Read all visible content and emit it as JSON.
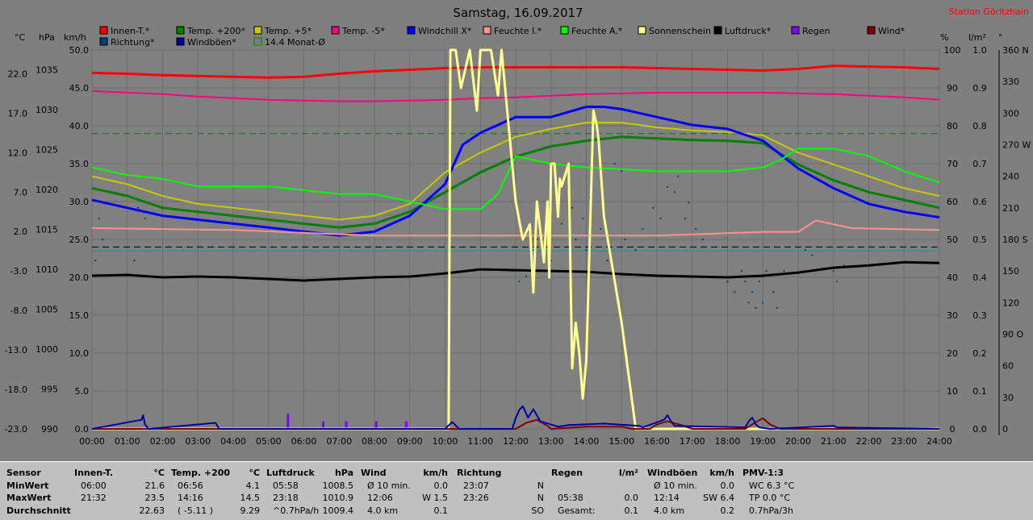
{
  "title": "Samstag, 16.09.2017",
  "station": "Station Göritzhain",
  "units": {
    "celsius": "°C",
    "hpa": "hPa",
    "kmh": "km/h",
    "percent": "%",
    "lm2": "l/m²",
    "degree": "°"
  },
  "legend": [
    {
      "label": "Innen-T.*",
      "color": "#ff0000"
    },
    {
      "label": "Temp. +200*",
      "color": "#008000"
    },
    {
      "label": "Temp. +5*",
      "color": "#c8c800"
    },
    {
      "label": "Temp. -5*",
      "color": "#ff0080"
    },
    {
      "label": "Windchill X*",
      "color": "#0000ff"
    },
    {
      "label": "Feuchte I.*",
      "color": "#ff9090"
    },
    {
      "label": "Feuchte A.*",
      "color": "#00ff00"
    },
    {
      "label": "Sonnenschein",
      "color": "#ffff90"
    },
    {
      "label": "Luftdruck*",
      "color": "#000000"
    },
    {
      "label": "Regen",
      "color": "#8000ff"
    },
    {
      "label": "Wind*",
      "color": "#800000"
    },
    {
      "label": "Richtung*",
      "color": "#004080"
    },
    {
      "label": "Windböen*",
      "color": "#0000a0"
    },
    {
      "label": "14.4 Monat-Ø",
      "color": "#008000",
      "outline": true
    }
  ],
  "chart_data": {
    "type": "line",
    "title": "Samstag, 16.09.2017",
    "x_ticks": [
      "00:00",
      "01:00",
      "02:00",
      "03:00",
      "04:00",
      "05:00",
      "06:00",
      "07:00",
      "08:00",
      "09:00",
      "10:00",
      "11:00",
      "12:00",
      "13:00",
      "14:00",
      "15:00",
      "16:00",
      "17:00",
      "18:00",
      "19:00",
      "20:00",
      "21:00",
      "22:00",
      "23:00",
      "24:00"
    ],
    "xlim": [
      0,
      24
    ],
    "axes": {
      "celsius": {
        "ticks": [
          "22.0",
          "17.0",
          "12.0",
          "7.0",
          "2.0",
          "-3.0",
          "-8.0",
          "-13.0",
          "-18.0",
          "-23.0"
        ],
        "ylim": [
          -23,
          25
        ]
      },
      "hpa": {
        "ticks": [
          "1035",
          "1030",
          "1025",
          "1020",
          "1015",
          "1010",
          "1005",
          "1000",
          "995",
          "990"
        ],
        "ylim": [
          990,
          1037.5
        ]
      },
      "kmh": {
        "ticks": [
          "50.0",
          "45.0",
          "40.0",
          "35.0",
          "30.0",
          "25.0",
          "20.0",
          "15.0",
          "10.0",
          "5.0",
          "0.0"
        ],
        "ylim": [
          0,
          50
        ]
      },
      "percent": {
        "ticks": [
          "100",
          "90",
          "80",
          "70",
          "60",
          "50",
          "40",
          "30",
          "20",
          "10",
          "0"
        ],
        "ylim": [
          0,
          100
        ]
      },
      "lm2": {
        "ticks": [
          "1.0",
          "0.9",
          "0.8",
          "0.7",
          "0.6",
          "0.5",
          "0.4",
          "0.3",
          "0.2",
          "0.1",
          "0.0"
        ],
        "ylim": [
          0,
          1
        ]
      },
      "degree": {
        "ticks": [
          "360 N",
          "330",
          "300",
          "270 W",
          "240",
          "210",
          "180 S",
          "150",
          "120",
          "90 O",
          "60",
          "30",
          "0"
        ],
        "ylim": [
          0,
          360
        ]
      }
    },
    "reference_lines": [
      {
        "name": "14.4 Monat-Ø",
        "y_celsius": 14.4,
        "color": "#008000",
        "style": "dashed"
      },
      {
        "y_kmh": 24.0,
        "color": "#000000",
        "style": "dashed"
      },
      {
        "y_kmh": 23.5,
        "color": "#00a0a0",
        "style": "solid"
      }
    ],
    "series": [
      {
        "name": "Innen-T.*",
        "axis": "celsius",
        "color": "#ff0000",
        "width": 3,
        "x": [
          0,
          1,
          2,
          3,
          4,
          5,
          6,
          7,
          8,
          9,
          10,
          11,
          12,
          13,
          14,
          15,
          16,
          17,
          18,
          19,
          20,
          21,
          22,
          23,
          24
        ],
        "y": [
          22.1,
          22.0,
          21.8,
          21.7,
          21.6,
          21.5,
          21.6,
          22.0,
          22.3,
          22.5,
          22.7,
          22.8,
          22.8,
          22.8,
          22.8,
          22.8,
          22.7,
          22.6,
          22.5,
          22.4,
          22.6,
          23.0,
          22.9,
          22.8,
          22.6
        ]
      },
      {
        "name": "Temp. -5*",
        "axis": "celsius",
        "color": "#ff0080",
        "width": 2,
        "x": [
          0,
          1,
          2,
          3,
          4,
          5,
          6,
          7,
          8,
          9,
          10,
          11,
          12,
          13,
          14,
          15,
          16,
          17,
          18,
          19,
          20,
          21,
          22,
          23,
          24
        ],
        "y": [
          19.8,
          19.6,
          19.4,
          19.1,
          18.9,
          18.7,
          18.6,
          18.5,
          18.5,
          18.6,
          18.7,
          18.9,
          19.0,
          19.2,
          19.4,
          19.5,
          19.6,
          19.6,
          19.6,
          19.6,
          19.5,
          19.4,
          19.2,
          19.0,
          18.7
        ]
      },
      {
        "name": "Temp. +5*",
        "axis": "celsius",
        "color": "#c8c800",
        "width": 2,
        "x": [
          0,
          1,
          2,
          3,
          4,
          5,
          6,
          7,
          8,
          9,
          10,
          11,
          12,
          13,
          14,
          15,
          16,
          17,
          18,
          19,
          20,
          21,
          22,
          23,
          24
        ],
        "y": [
          9.0,
          8.0,
          6.5,
          5.5,
          5.0,
          4.5,
          4.0,
          3.5,
          4.0,
          5.5,
          9.5,
          12.0,
          14.0,
          15.0,
          15.8,
          15.8,
          15.2,
          14.8,
          14.6,
          14.2,
          12.0,
          10.5,
          9.0,
          7.5,
          6.5
        ]
      },
      {
        "name": "Temp. +200*",
        "axis": "celsius",
        "color": "#008000",
        "width": 3,
        "x": [
          0,
          1,
          2,
          3,
          4,
          5,
          6,
          7,
          8,
          9,
          10,
          11,
          12,
          13,
          14,
          15,
          16,
          17,
          18,
          19,
          20,
          21,
          22,
          23,
          24
        ],
        "y": [
          7.5,
          6.5,
          5.0,
          4.5,
          4.0,
          3.5,
          3.0,
          2.5,
          3.0,
          4.5,
          7.0,
          9.5,
          11.5,
          12.8,
          13.5,
          14.0,
          13.8,
          13.6,
          13.5,
          13.2,
          10.5,
          8.5,
          7.0,
          6.0,
          5.0
        ]
      },
      {
        "name": "Windchill X*",
        "axis": "celsius",
        "color": "#0000ff",
        "width": 3,
        "x": [
          0,
          1,
          2,
          3,
          4,
          5,
          6,
          7,
          8,
          9,
          10,
          10.5,
          11,
          12,
          13,
          14,
          14.5,
          15,
          16,
          17,
          18,
          19,
          20,
          21,
          22,
          23,
          24
        ],
        "y": [
          6.0,
          5.0,
          4.0,
          3.5,
          3.0,
          2.5,
          2.0,
          1.5,
          2.0,
          4.0,
          8.0,
          13.0,
          14.5,
          16.5,
          16.5,
          17.8,
          17.8,
          17.5,
          16.5,
          15.5,
          15.0,
          13.5,
          10.0,
          7.5,
          5.5,
          4.5,
          3.8
        ]
      },
      {
        "name": "Feuchte I.*",
        "axis": "percent",
        "color": "#ff9090",
        "width": 2,
        "x": [
          0,
          4,
          8,
          9,
          12,
          16,
          19,
          20,
          20.5,
          21.5,
          24
        ],
        "y": [
          53,
          52.5,
          51,
          51,
          51,
          51,
          52,
          52,
          55,
          53,
          52.5
        ]
      },
      {
        "name": "Feuchte A.*",
        "axis": "percent",
        "color": "#00ff00",
        "width": 2,
        "x": [
          0,
          1,
          2,
          3,
          4,
          5,
          6,
          7,
          8,
          9,
          10,
          11,
          11.5,
          12,
          13,
          14,
          15,
          16,
          17,
          18,
          19,
          19.5,
          20,
          21,
          22,
          23,
          24
        ],
        "y": [
          69,
          67,
          66,
          64,
          64,
          64,
          63,
          62,
          62,
          60,
          58,
          58,
          62,
          72,
          70,
          69,
          68.5,
          68,
          68,
          68,
          69,
          71,
          74,
          74,
          72,
          68,
          65
        ]
      },
      {
        "name": "Luftdruck*",
        "axis": "hpa",
        "color": "#000000",
        "width": 3,
        "x": [
          0,
          1,
          2,
          3,
          4,
          5,
          6,
          7,
          8,
          9,
          10,
          11,
          12,
          13,
          14,
          15,
          16,
          17,
          18,
          19,
          20,
          21,
          22,
          23,
          24
        ],
        "y": [
          1009.2,
          1009.3,
          1009.0,
          1009.1,
          1009.0,
          1008.8,
          1008.6,
          1008.8,
          1009.0,
          1009.1,
          1009.5,
          1010.0,
          1009.9,
          1009.8,
          1009.7,
          1009.4,
          1009.2,
          1009.1,
          1009.0,
          1009.2,
          1009.6,
          1010.2,
          1010.5,
          1010.9,
          1010.8
        ]
      },
      {
        "name": "Sonnenschein",
        "axis": "kmh",
        "color": "#ffff90",
        "width": 3,
        "x": [
          0,
          10.1,
          10.15,
          10.3,
          10.45,
          10.7,
          10.9,
          11.0,
          11.3,
          11.5,
          11.6,
          11.9,
          12.0,
          12.2,
          12.4,
          12.5,
          12.6,
          12.8,
          12.9,
          12.95,
          13.0,
          13.1,
          13.2,
          13.25,
          13.3,
          13.5,
          13.6,
          13.7,
          13.8,
          13.9,
          14.0,
          14.2,
          14.3,
          14.35,
          14.5,
          15.0,
          15.4,
          24
        ],
        "y": [
          0,
          0,
          50,
          50,
          45,
          50,
          42,
          50,
          50,
          44,
          50,
          35,
          30,
          25,
          27,
          18,
          30,
          22,
          30,
          20,
          35,
          35,
          28,
          33,
          32,
          35,
          8,
          14,
          10,
          4,
          9,
          42,
          40,
          38,
          28,
          14,
          0,
          0
        ]
      },
      {
        "name": "Wind*",
        "axis": "kmh",
        "color": "#800000",
        "width": 2,
        "x": [
          0,
          12,
          12.3,
          12.6,
          12.9,
          13,
          14,
          15,
          15.3,
          15.8,
          16,
          16.3,
          16.7,
          17,
          18.5,
          18.8,
          19,
          19.2,
          19.5,
          24
        ],
        "y": [
          0,
          0,
          0.8,
          1.2,
          0.4,
          0,
          0.3,
          0.3,
          0,
          0,
          0.6,
          1.0,
          0.5,
          0,
          0,
          0.9,
          1.4,
          0.6,
          0,
          0
        ]
      },
      {
        "name": "Windböen*",
        "axis": "kmh",
        "color": "#0000a0",
        "width": 2,
        "x": [
          0,
          1.4,
          1.45,
          1.5,
          1.6,
          3.5,
          3.55,
          3.6,
          10,
          10.2,
          10.4,
          11.9,
          12,
          12.1,
          12.2,
          12.35,
          12.5,
          12.7,
          13.2,
          13.5,
          14.5,
          15.5,
          15.6,
          16.2,
          16.3,
          16.4,
          16.5,
          18.5,
          18.6,
          18.7,
          18.8,
          18.9,
          19.2,
          21,
          21.1,
          24
        ],
        "y": [
          0,
          1.2,
          1.8,
          0.6,
          0,
          0.8,
          0.4,
          0,
          0,
          0.9,
          0,
          0,
          1.4,
          2.5,
          3.0,
          1.5,
          2.6,
          1.0,
          0.3,
          0.5,
          0.7,
          0.4,
          0.2,
          1.2,
          1.8,
          1.0,
          0.4,
          0.2,
          1.0,
          1.5,
          0.6,
          0.2,
          0,
          0.4,
          0.2,
          0
        ]
      }
    ],
    "richtung_points": {
      "axis": "degree",
      "color": "#004080",
      "points": [
        [
          0.2,
          200
        ],
        [
          0.3,
          180
        ],
        [
          1.3,
          210
        ],
        [
          1.5,
          200
        ],
        [
          0.1,
          160
        ],
        [
          1.2,
          160
        ],
        [
          11.9,
          150
        ],
        [
          12.1,
          140
        ],
        [
          12.3,
          145
        ],
        [
          12.5,
          170
        ],
        [
          12.6,
          180
        ],
        [
          12.8,
          170
        ],
        [
          13.0,
          160
        ],
        [
          13.3,
          195
        ],
        [
          13.6,
          210
        ],
        [
          13.7,
          180
        ],
        [
          13.9,
          200
        ],
        [
          14.0,
          170
        ],
        [
          14.1,
          220
        ],
        [
          14.4,
          190
        ],
        [
          14.6,
          160
        ],
        [
          15.1,
          180
        ],
        [
          15.4,
          170
        ],
        [
          15.6,
          190
        ],
        [
          15.9,
          210
        ],
        [
          16.1,
          200
        ],
        [
          16.3,
          230
        ],
        [
          16.6,
          240
        ],
        [
          16.8,
          200
        ],
        [
          17.1,
          190
        ],
        [
          17.3,
          180
        ],
        [
          18.0,
          140
        ],
        [
          18.2,
          130
        ],
        [
          18.4,
          150
        ],
        [
          18.5,
          140
        ],
        [
          18.6,
          120
        ],
        [
          18.7,
          130
        ],
        [
          18.8,
          115
        ],
        [
          18.9,
          140
        ],
        [
          19.0,
          120
        ],
        [
          19.1,
          150
        ],
        [
          19.3,
          130
        ],
        [
          19.4,
          115
        ],
        [
          19.6,
          150
        ],
        [
          20.2,
          170
        ],
        [
          20.4,
          165
        ],
        [
          21.0,
          150
        ],
        [
          21.1,
          140
        ],
        [
          21.3,
          155
        ],
        [
          14.8,
          252
        ],
        [
          15.0,
          245
        ],
        [
          16.5,
          225
        ],
        [
          16.9,
          215
        ]
      ]
    },
    "regen_bars": {
      "axis": "lm2",
      "color": "#8000ff",
      "x": [
        5.55,
        6.55,
        7.2,
        8.05,
        8.9
      ],
      "y": [
        0.04,
        0.02,
        0.02,
        0.02,
        0.02
      ]
    }
  },
  "stats": {
    "columns": [
      {
        "key": "sensor",
        "header": "Sensor",
        "rows": [
          "MinWert",
          "MaxWert",
          "Durchschnitt"
        ]
      },
      {
        "key": "innen",
        "header": "Innen-T.",
        "unit": "°C",
        "rows": [
          [
            "06:00",
            "21.6"
          ],
          [
            "21:32",
            "23.5"
          ],
          [
            "",
            "22.63"
          ]
        ]
      },
      {
        "key": "temp200",
        "header": "Temp. +200",
        "unit": "°C",
        "rows": [
          [
            "06:56",
            "4.1"
          ],
          [
            "14:16",
            "14.5"
          ],
          [
            "( -5.11 )",
            "9.29"
          ]
        ]
      },
      {
        "key": "luftdruck",
        "header": "Luftdruck",
        "unit": "hPa",
        "rows": [
          [
            "05:58",
            "1008.5"
          ],
          [
            "23:18",
            "1010.9"
          ],
          [
            "^0.7hPa/h",
            "1009.4"
          ]
        ]
      },
      {
        "key": "wind",
        "header": "Wind",
        "unit": "km/h",
        "rows": [
          [
            "Ø 10 min.",
            "0.0"
          ],
          [
            "12:06",
            "W 1.5"
          ],
          [
            "4.0 km",
            "0.1"
          ]
        ]
      },
      {
        "key": "richtung",
        "header": "Richtung",
        "unit": "",
        "rows": [
          [
            "23:07",
            "N"
          ],
          [
            "23:26",
            "N"
          ],
          [
            "",
            "SO"
          ]
        ]
      },
      {
        "key": "regen",
        "header": "Regen",
        "unit": "l/m²",
        "rows": [
          [
            "",
            ""
          ],
          [
            "05:38",
            "0.0"
          ],
          [
            "Gesamt:",
            "0.1"
          ]
        ]
      },
      {
        "key": "windboeen",
        "header": "Windböen",
        "unit": "km/h",
        "rows": [
          [
            "Ø 10 min.",
            "0.0"
          ],
          [
            "12:14",
            "SW 6.4"
          ],
          [
            "4.0 km",
            "0.2"
          ]
        ]
      },
      {
        "key": "pmv",
        "header": "PMV-1:3",
        "unit": "",
        "rows": [
          [
            "WC 6.3 °C",
            ""
          ],
          [
            "TP 0.0 °C",
            ""
          ],
          [
            "0.7hPa/3h",
            ""
          ]
        ]
      }
    ]
  }
}
